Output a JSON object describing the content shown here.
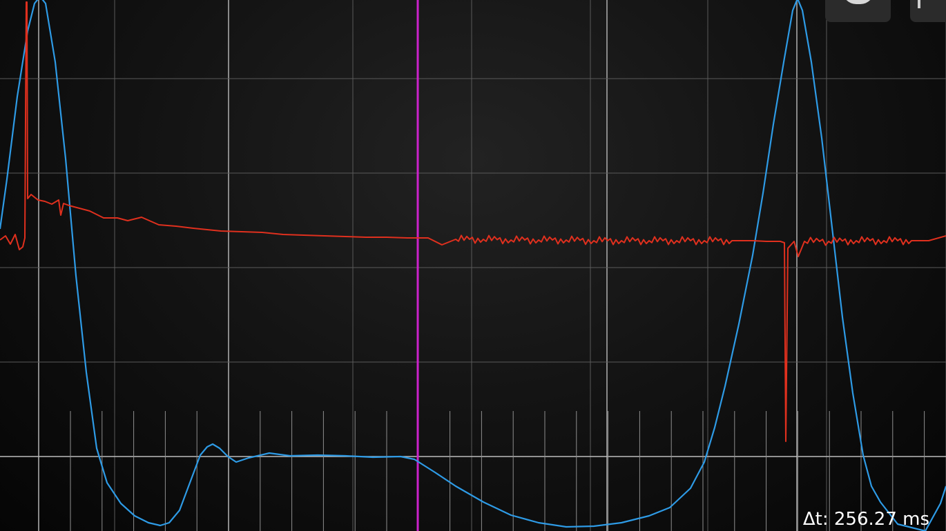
{
  "readout": {
    "delta_t": "Δt: 256.27 ms"
  },
  "toolbar": {
    "buttons": [
      {
        "name": "toolbar-button-1",
        "icon": "knob-icon"
      },
      {
        "name": "toolbar-button-2",
        "icon": "bar-icon"
      }
    ]
  },
  "colors": {
    "background": "#111111",
    "grid": "#5a5a5a",
    "grid_major": "#8a8a8a",
    "cursor": "#cc22cc",
    "channel_1": "#e0301e",
    "channel_2": "#2e9be6"
  },
  "chart_data": {
    "type": "line",
    "grid": true,
    "series": [
      {
        "channel": 1,
        "color": "#e0301e",
        "points": [
          [
            0,
            348
          ],
          [
            8,
            342
          ],
          [
            15,
            354
          ],
          [
            22,
            340
          ],
          [
            28,
            362
          ],
          [
            33,
            358
          ],
          [
            36,
            345
          ],
          [
            38,
            3
          ],
          [
            39,
            3
          ],
          [
            40,
            288
          ],
          [
            45,
            282
          ],
          [
            55,
            290
          ],
          [
            65,
            292
          ],
          [
            75,
            296
          ],
          [
            85,
            290
          ],
          [
            88,
            312
          ],
          [
            92,
            295
          ],
          [
            100,
            298
          ],
          [
            115,
            302
          ],
          [
            130,
            306
          ],
          [
            150,
            316
          ],
          [
            170,
            316
          ],
          [
            185,
            320
          ],
          [
            205,
            315
          ],
          [
            230,
            326
          ],
          [
            255,
            328
          ],
          [
            280,
            331
          ],
          [
            300,
            333
          ],
          [
            320,
            335
          ],
          [
            350,
            336
          ],
          [
            380,
            337
          ],
          [
            410,
            340
          ],
          [
            440,
            341
          ],
          [
            470,
            342
          ],
          [
            500,
            343
          ],
          [
            530,
            344
          ],
          [
            560,
            344
          ],
          [
            590,
            345
          ],
          [
            620,
            345
          ],
          [
            640,
            355
          ],
          [
            660,
            347
          ],
          [
            700,
            347
          ],
          [
            740,
            348
          ],
          [
            780,
            348
          ],
          [
            820,
            348
          ],
          [
            860,
            349
          ],
          [
            900,
            349
          ],
          [
            940,
            349
          ],
          [
            980,
            349
          ],
          [
            1020,
            349
          ],
          [
            1060,
            349
          ],
          [
            1090,
            349
          ],
          [
            1110,
            350
          ],
          [
            1130,
            350
          ],
          [
            1136,
            352
          ],
          [
            1138,
            640
          ],
          [
            1141,
            360
          ],
          [
            1150,
            350
          ],
          [
            1156,
            372
          ],
          [
            1165,
            350
          ],
          [
            1200,
            350
          ],
          [
            1240,
            349
          ],
          [
            1280,
            349
          ],
          [
            1320,
            349
          ],
          [
            1345,
            349
          ],
          [
            1370,
            342
          ]
        ]
      },
      {
        "channel": 2,
        "color": "#2e9be6",
        "points": [
          [
            0,
            332
          ],
          [
            10,
            260
          ],
          [
            25,
            140
          ],
          [
            40,
            45
          ],
          [
            50,
            5
          ],
          [
            58,
            -5
          ],
          [
            66,
            5
          ],
          [
            80,
            90
          ],
          [
            95,
            230
          ],
          [
            110,
            400
          ],
          [
            125,
            540
          ],
          [
            140,
            650
          ],
          [
            155,
            700
          ],
          [
            175,
            730
          ],
          [
            195,
            748
          ],
          [
            215,
            758
          ],
          [
            232,
            762
          ],
          [
            245,
            758
          ],
          [
            260,
            740
          ],
          [
            275,
            700
          ],
          [
            290,
            660
          ],
          [
            300,
            648
          ],
          [
            308,
            644
          ],
          [
            318,
            650
          ],
          [
            330,
            662
          ],
          [
            342,
            670
          ],
          [
            360,
            664
          ],
          [
            390,
            657
          ],
          [
            420,
            661
          ],
          [
            460,
            660
          ],
          [
            500,
            661
          ],
          [
            540,
            663
          ],
          [
            580,
            662
          ],
          [
            600,
            666
          ],
          [
            630,
            685
          ],
          [
            660,
            705
          ],
          [
            700,
            728
          ],
          [
            740,
            747
          ],
          [
            780,
            758
          ],
          [
            820,
            764
          ],
          [
            860,
            763
          ],
          [
            900,
            758
          ],
          [
            940,
            748
          ],
          [
            970,
            736
          ],
          [
            1000,
            708
          ],
          [
            1020,
            670
          ],
          [
            1035,
            620
          ],
          [
            1050,
            560
          ],
          [
            1070,
            470
          ],
          [
            1090,
            370
          ],
          [
            1105,
            280
          ],
          [
            1120,
            180
          ],
          [
            1135,
            90
          ],
          [
            1148,
            15
          ],
          [
            1155,
            -2
          ],
          [
            1162,
            15
          ],
          [
            1175,
            90
          ],
          [
            1190,
            200
          ],
          [
            1205,
            330
          ],
          [
            1220,
            460
          ],
          [
            1235,
            570
          ],
          [
            1250,
            660
          ],
          [
            1262,
            705
          ],
          [
            1275,
            728
          ],
          [
            1300,
            760
          ],
          [
            1340,
            770
          ],
          [
            1362,
            730
          ],
          [
            1370,
            705
          ]
        ]
      }
    ]
  }
}
